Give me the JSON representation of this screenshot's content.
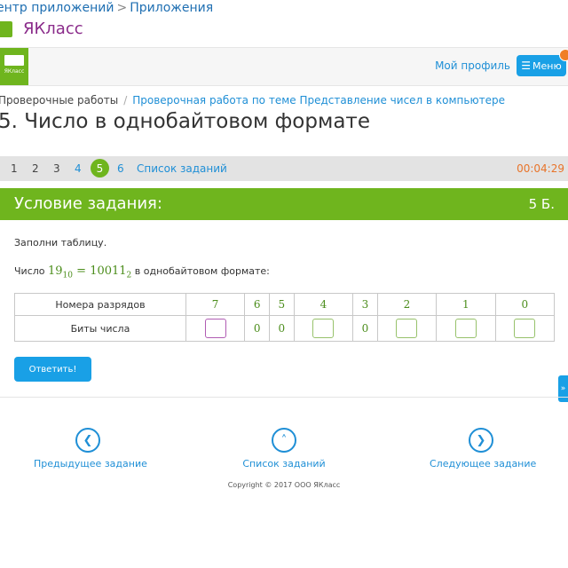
{
  "top_breadcrumb": {
    "item1": "ентр приложений",
    "separator": ">",
    "item2": "Приложения"
  },
  "brand": {
    "name": "ЯКласс"
  },
  "header": {
    "logo_text": "ЯКласс",
    "profile_link": "Мой профиль",
    "menu_label": "Меню"
  },
  "page_breadcrumb": {
    "item1": "Проверочные работы",
    "separator": "/",
    "item2": "Проверочная работа по теме Представление чисел в компьютере"
  },
  "page_title": "5. Число в однобайтовом формате",
  "pager": {
    "pages": [
      "1",
      "2",
      "3",
      "4",
      "5",
      "6"
    ],
    "current": "5",
    "task_list": "Список заданий",
    "timer": "00:04:29"
  },
  "task": {
    "header": "Условие задания:",
    "score": "5 Б.",
    "instruction": "Заполни таблицу.",
    "statement_prefix": "Число",
    "decimal": "19",
    "decimal_base": "10",
    "equals": "=",
    "binary": "10011",
    "binary_base": "2",
    "statement_suffix": "в однобайтовом формате:"
  },
  "table": {
    "row1_label": "Номера разрядов",
    "row2_label": "Биты числа",
    "positions": [
      "7",
      "6",
      "5",
      "4",
      "3",
      "2",
      "1",
      "0"
    ],
    "bits": [
      "",
      "0",
      "0",
      "",
      "0",
      "",
      "",
      ""
    ]
  },
  "answer_button": "Ответить!",
  "side_tab": "»",
  "footer_nav": {
    "prev": "Предыдущее задание",
    "list": "Список заданий",
    "next": "Следующее задание"
  },
  "copyright": "Copyright © 2017 ООО ЯКласс",
  "colors": {
    "green": "#6fb51e",
    "blue": "#1f8fd6",
    "button_blue": "#19a0e6",
    "timer_orange": "#e8742a",
    "brand_purple": "#8a2b8a"
  },
  "icons": {
    "prev": "chevron-left-icon",
    "list": "chevron-up-icon",
    "next": "chevron-right-icon",
    "menu": "hamburger-icon"
  }
}
